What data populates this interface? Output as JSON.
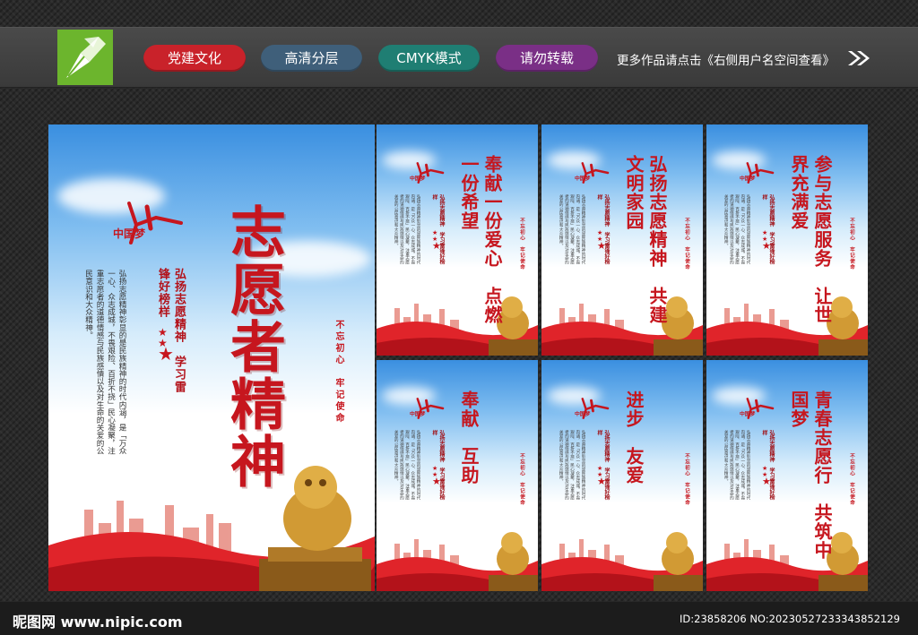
{
  "header": {
    "tags": [
      "党建文化",
      "高清分层",
      "CMYK模式",
      "请勿转载"
    ],
    "more_text": "更多作品请点击《右侧用户名空间查看》",
    "logo_icon": "pen-nib-icon",
    "arrow_icon": "double-chevron-right-icon"
  },
  "big_poster": {
    "title": "志愿者精神",
    "slogan": "弘扬志愿精神　学习雷锋好榜样",
    "paragraph": "弘扬志愿精神彰显的是民族精神的时代内涵，是「万众一心、众志成城，不畏艰险、百折不挠」民心凝聚，注重志愿者的道德情感与民族感情以及对生命的关爱的公民意识和大众精神。",
    "seal": "不忘初心　牢记使命",
    "logo_text": "中国梦"
  },
  "small_posters": [
    {
      "headline": "奉献一份爱心　点燃一份希望"
    },
    {
      "headline": "弘扬志愿精神　共建文明家园"
    },
    {
      "headline": "参与志愿服务　让世界充满爱"
    },
    {
      "headline": "奉献　互助"
    },
    {
      "headline": "进步　友爱"
    },
    {
      "headline": "青春志愿行　共筑中国梦"
    }
  ],
  "footer": {
    "site": "昵图网 www.nipic.com",
    "image_id": "ID:23858206 NO:20230527233343852129"
  },
  "colors": {
    "brand_red": "#c6161e",
    "logo_green": "#6cb52d",
    "sky_blue": "#3a8fe0"
  }
}
